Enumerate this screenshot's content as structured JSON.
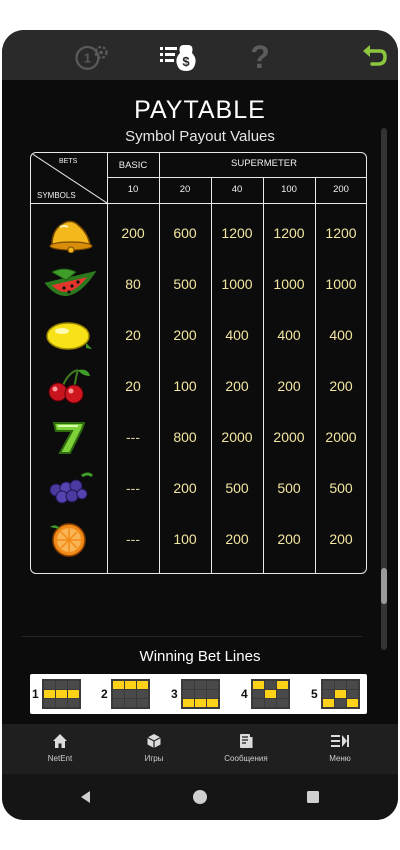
{
  "toolbar": {
    "items": [
      {
        "name": "coins-settings",
        "icon": "coins-gear-icon"
      },
      {
        "name": "paytable",
        "icon": "paytable-icon"
      },
      {
        "name": "help",
        "icon": "help-icon",
        "glyph": "?"
      },
      {
        "name": "back",
        "icon": "back-arrow-icon",
        "color": "#8cc63f"
      }
    ]
  },
  "paytable": {
    "title": "PAYTABLE",
    "subtitle": "Symbol Payout Values",
    "header": {
      "bets": "BETS",
      "symbols": "SYMBOLS",
      "basic": "BASIC",
      "supermeter": "SUPERMETER",
      "bet_values": [
        "10",
        "20",
        "40",
        "100",
        "200"
      ]
    },
    "rows": [
      {
        "symbol": "bell",
        "values": [
          "200",
          "600",
          "1200",
          "1200",
          "1200"
        ]
      },
      {
        "symbol": "watermelon",
        "values": [
          "80",
          "500",
          "1000",
          "1000",
          "1000"
        ]
      },
      {
        "symbol": "lemon",
        "values": [
          "20",
          "200",
          "400",
          "400",
          "400"
        ]
      },
      {
        "symbol": "cherries",
        "values": [
          "20",
          "100",
          "200",
          "200",
          "200"
        ]
      },
      {
        "symbol": "seven",
        "values": [
          "---",
          "800",
          "2000",
          "2000",
          "2000"
        ]
      },
      {
        "symbol": "grapes",
        "values": [
          "---",
          "200",
          "500",
          "500",
          "500"
        ]
      },
      {
        "symbol": "orange",
        "values": [
          "---",
          "100",
          "200",
          "200",
          "200"
        ]
      }
    ]
  },
  "bet_lines": {
    "title": "Winning Bet Lines",
    "lines": [
      {
        "number": "1",
        "highlight_row": 1
      },
      {
        "number": "2",
        "highlight_row": 0
      },
      {
        "number": "3",
        "highlight_row": 2
      },
      {
        "number": "4",
        "pattern": "v"
      },
      {
        "number": "5",
        "pattern": "inverted-v"
      }
    ]
  },
  "site_nav": {
    "items": [
      {
        "label": "NetEnt",
        "icon": "home-icon"
      },
      {
        "label": "Игры",
        "icon": "cube-icon"
      },
      {
        "label": "Сообщения",
        "icon": "messages-icon"
      },
      {
        "label": "Меню",
        "icon": "menu-icon"
      }
    ]
  },
  "android_nav": {
    "items": [
      "back-icon",
      "home-circle-icon",
      "recents-icon"
    ]
  },
  "colors": {
    "value_text": "#f2e6a0",
    "line_highlight": "#ffd21a",
    "back_arrow": "#8cc63f"
  }
}
